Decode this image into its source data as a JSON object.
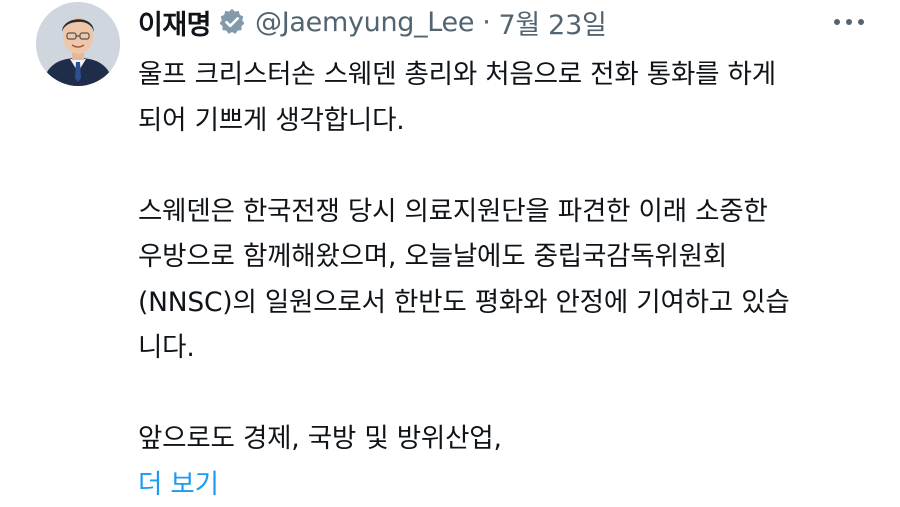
{
  "tweet": {
    "author": {
      "display_name": "이재명",
      "handle": "@Jaemyung_Lee",
      "verified_icon": "verified-badge-icon",
      "avatar": "avatar-photo"
    },
    "separator": "·",
    "date": "7월 23일",
    "more_icon": "more-options-icon",
    "paragraphs": [
      {
        "lines": [
          "울프 크리스터손 스웨덴 총리와 처음으로 전화 통화를 하게",
          "되어 기쁘게 생각합니다."
        ]
      },
      {
        "lines": [
          "스웨덴은 한국전쟁 당시 의료지원단을 파견한 이래 소중한",
          "우방으로 함께해왔으며, 오늘날에도 중립국감독위원회",
          "(NNSC)의 일원으로서 한반도 평화와 안정에 기여하고 있습",
          "니다."
        ]
      },
      {
        "lines": [
          "앞으로도 경제, 국방 및 방위산업,"
        ]
      }
    ],
    "show_more": "더 보기"
  },
  "colors": {
    "text": "#0f1419",
    "secondary": "#536471",
    "link": "#1d9bf0",
    "verified_badge": "#829aab"
  }
}
